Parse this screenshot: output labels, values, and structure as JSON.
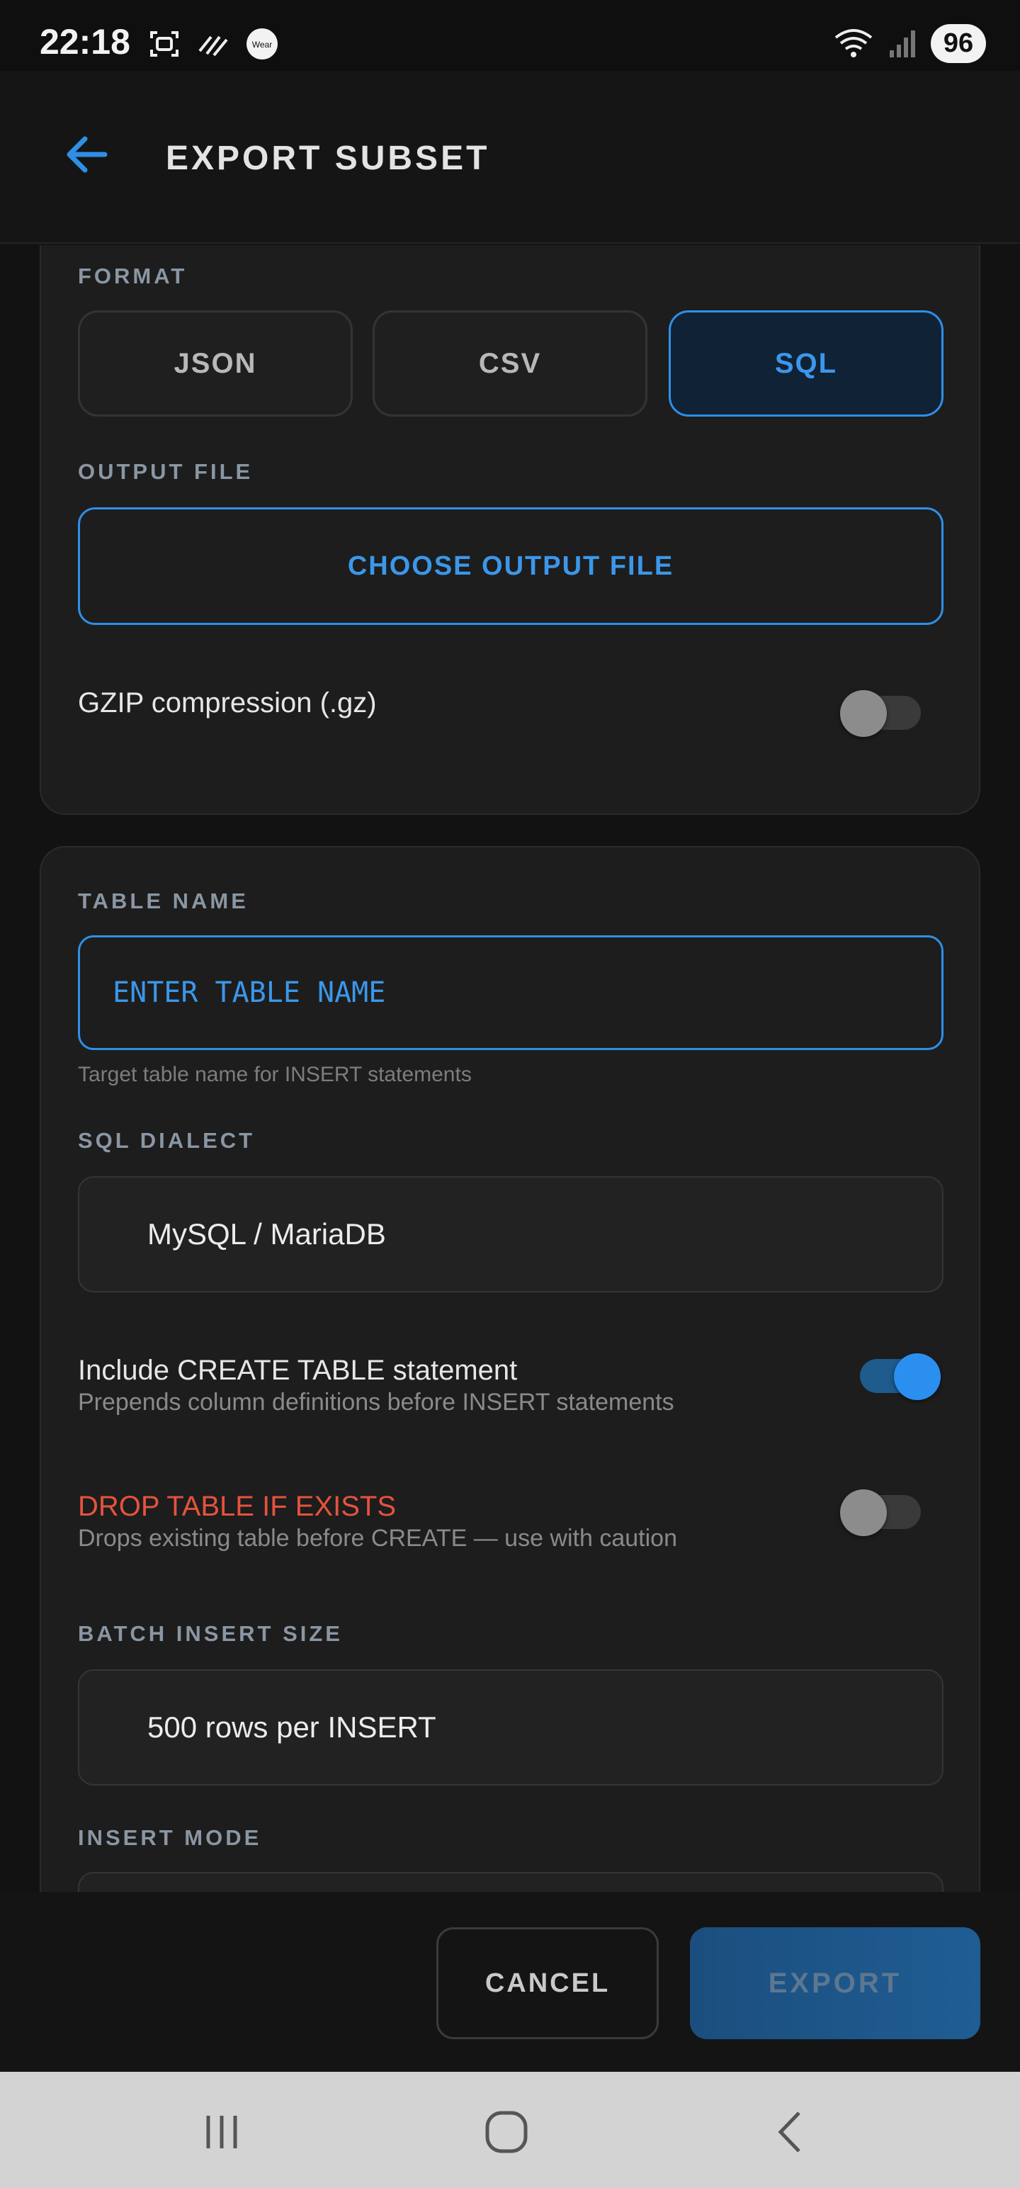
{
  "status_bar": {
    "time": "22:18",
    "battery": "96",
    "icons": [
      "screenshot-icon",
      "signal-slash-icon",
      "wear-icon",
      "wifi-icon",
      "cell-signal-icon"
    ]
  },
  "app_bar": {
    "title": "EXPORT SUBSET",
    "back_icon": "arrow-left-icon",
    "accent_color": "#2f8fe6"
  },
  "format": {
    "label": "FORMAT",
    "options": [
      "JSON",
      "CSV",
      "SQL"
    ],
    "selected": "SQL"
  },
  "output_file": {
    "label": "OUTPUT FILE",
    "button": "CHOOSE OUTPUT FILE"
  },
  "gzip": {
    "label": "GZIP compression (.gz)",
    "enabled": false
  },
  "table_name": {
    "label": "TABLE NAME",
    "placeholder": "ENTER TABLE NAME",
    "helper": "Target table name for INSERT statements"
  },
  "sql_dialect": {
    "label": "SQL DIALECT",
    "value": "MySQL / MariaDB"
  },
  "create_table": {
    "label": "Include CREATE TABLE statement",
    "sub": "Prepends column definitions before INSERT statements",
    "enabled": true
  },
  "drop_table": {
    "label": "DROP TABLE IF EXISTS",
    "sub": "Drops existing table before CREATE — use with caution",
    "enabled": false,
    "warning_color": "#e5533d"
  },
  "batch": {
    "label": "BATCH INSERT SIZE",
    "value": "500 rows per INSERT"
  },
  "insert_mode": {
    "label": "INSERT MODE"
  },
  "footer": {
    "cancel": "CANCEL",
    "export": "EXPORT"
  },
  "nav": {
    "icons": [
      "recents-icon",
      "home-icon",
      "back-icon"
    ]
  }
}
